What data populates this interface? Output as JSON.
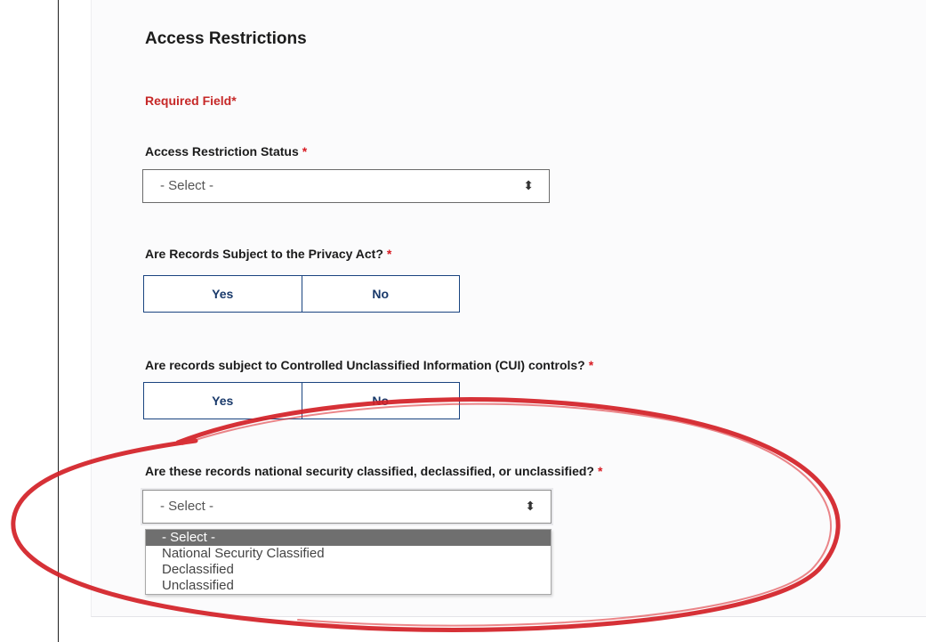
{
  "section": {
    "heading": "Access Restrictions",
    "required_note": "Required Field*"
  },
  "fields": {
    "access_status": {
      "label": "Access Restriction Status",
      "required_mark": "*",
      "value": "- Select -"
    },
    "privacy_act": {
      "label": "Are Records Subject to the Privacy Act?",
      "required_mark": "*",
      "yes": "Yes",
      "no": "No"
    },
    "cui": {
      "label": "Are records subject to Controlled Unclassified Information (CUI) controls?",
      "required_mark": "*",
      "yes": "Yes",
      "no": "No"
    },
    "classification": {
      "label": "Are these records national security classified, declassified, or unclassified?",
      "required_mark": "*",
      "value": "- Select -",
      "options": [
        "- Select -",
        "National Security Classified",
        "Declassified",
        "Unclassified"
      ],
      "selected_option": "- Select -"
    }
  },
  "icons": {
    "select_arrow": "updown-arrow-icon"
  },
  "colors": {
    "required": "#d81b23",
    "button_border": "#1a4480",
    "button_text": "#1a3a6b",
    "annotation": "#d21f26",
    "selected_option_bg": "#6f6f6f"
  }
}
